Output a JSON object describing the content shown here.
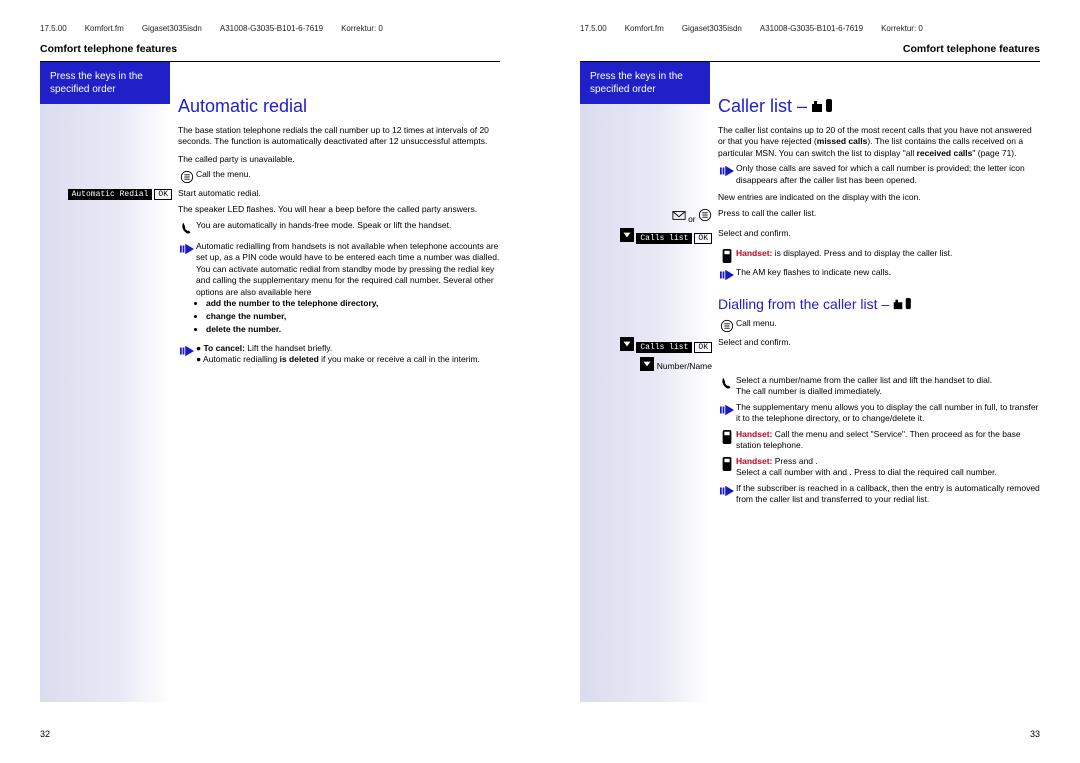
{
  "meta": {
    "date": "17.5.00",
    "file": "Komfort.fm",
    "product": "Gigaset3035isdn",
    "docnum": "A31008-G3035-B101-6-7619",
    "korr": "Korrektur: 0"
  },
  "section": "Comfort telephone features",
  "sidebar_hint": "Press the keys in the specified order",
  "left": {
    "title": "Automatic redial",
    "intro": "The base station telephone redials the call number up to 12 times at intervals of 20 seconds. The function is automatically deactivated after 12 unsuccessful attempts.",
    "unavail": "The called party is unavailable.",
    "callmenu": "Call the menu.",
    "menu_label": "Automatic Redial",
    "ok": "OK",
    "start": "Start automatic redial.",
    "speaker": "The speaker LED flashes. You will hear a beep before the called party answers.",
    "handsfree": "You are automatically in hands-free mode. Speak or lift the handset.",
    "note1a": "Automatic redialling from handsets is not available when telephone accounts are set up, as a PIN code would have to be entered each time a number was dialled.",
    "note1b": "You can activate automatic redial from standby mode by pressing the redial key and calling the supplementary menu for the required call number. Several other options are also available here",
    "opt1": "add the number to the telephone directory,",
    "opt2": "change the number,",
    "opt3": "delete the number.",
    "cancel_label": "To cancel:",
    "cancel_body": "Lift the handset briefly.",
    "deleted_a": "Automatic redialling ",
    "deleted_b": "is deleted",
    "deleted_c": " if you make or receive a call in the interim.",
    "pagenum": "32"
  },
  "right": {
    "title": "Caller list – ",
    "intro_a": "The caller list contains up to 20 of the most recent calls that you have not answered or that you have rejected (",
    "intro_b": "missed calls",
    "intro_c": "). The list contains the calls received on a particular MSN. You can switch the list to display \"all ",
    "intro_d": "received calls",
    "intro_e": "\" (page 71).",
    "note_saved": "Only those calls are saved for which a call number is provided; the letter icon disappears after the caller list has been opened.",
    "new_entries": "New entries are indicated on the display with the        icon.",
    "press_call": "Press to call the caller list.",
    "or": "or",
    "menu_calls": "Calls list",
    "ok": "OK",
    "select_confirm": "Select and confirm.",
    "handset1_a": "Handset:",
    "handset1_b": "        is displayed. Press        and        to display the caller list.",
    "amkey": "The AM key flashes to indicate new calls.",
    "subtitle": "Dialling from the caller list – ",
    "callmenu": "Call menu.",
    "number_name": "Number/Name",
    "select_lift": "Select a number/name from the caller list and lift the handset to dial.",
    "dial_immed": "The call number is dialled immediately.",
    "suppl": "The supplementary menu        allows you to display the call number in full, to transfer it to the telephone directory, or to change/delete it.",
    "handset2_a": "Handset:",
    "handset2_b": "       Call the menu and select \"Service\". Then proceed as for the base station telephone.",
    "handset3_a": "Handset:",
    "handset3_b": "Press        and       .",
    "handset3_c": "Select a call number with        and       . Press        to dial the required call number.",
    "note_callback": "If the subscriber is reached in a callback, then the entry is automatically removed from the caller list and transferred to your redial list.",
    "pagenum": "33"
  }
}
